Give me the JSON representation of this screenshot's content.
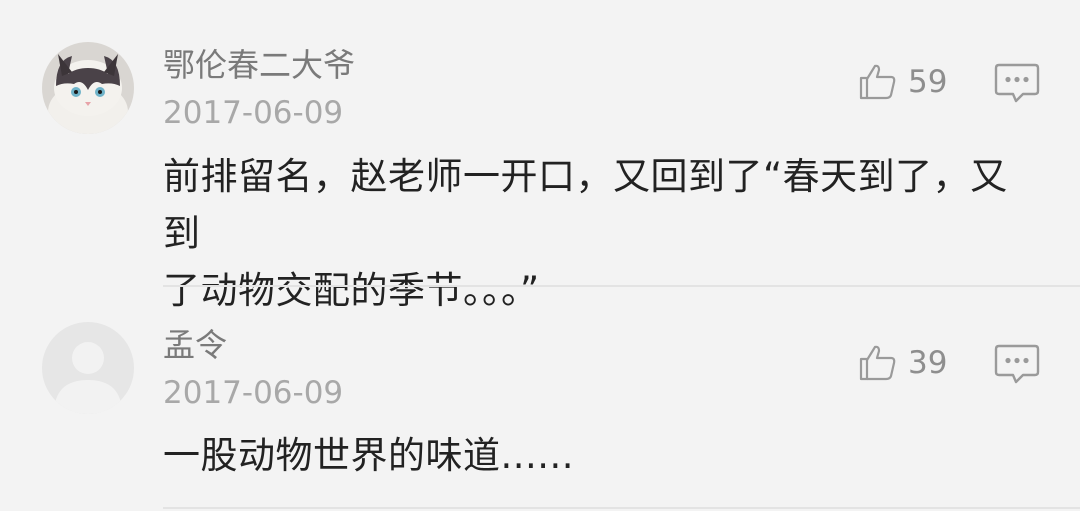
{
  "comments": [
    {
      "username": "鄂伦春二大爷",
      "date": "2017-06-09",
      "like_count": "59",
      "text_line1": "前排留名，赵老师一开口，又回到了“春天到了，又到",
      "text_line2": "了动物交配的季节。。。”"
    },
    {
      "username": "孟令",
      "date": "2017-06-09",
      "like_count": "39",
      "text_line1": "一股动物世界的味道......"
    }
  ],
  "icons": {
    "like": "thumbs-up-icon",
    "reply": "comment-bubble-icon",
    "avatar1": "cat-avatar",
    "avatar2": "default-avatar"
  },
  "colors": {
    "background": "#f3f3f3",
    "username": "#7a7a7a",
    "date": "#a8a8a8",
    "text": "#222222",
    "icon": "#9a9a9a"
  }
}
